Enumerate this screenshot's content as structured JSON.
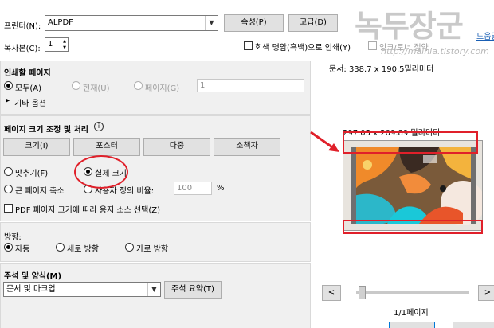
{
  "printer": {
    "label": "프린터(N):",
    "value": "ALPDF",
    "properties_label": "속성(P)",
    "advanced_label": "고급(D)"
  },
  "copies": {
    "label": "복사본(C):",
    "value": "1",
    "grayscale_label": "회색 명암(흑백)으로 인쇄(Y)",
    "save_ink_label": "잉크/토너 절약"
  },
  "watermark": {
    "text": "녹두장군",
    "url": "http://mainia.tistory.com"
  },
  "help_link": "도움말",
  "pages": {
    "heading": "인쇄할 페이지",
    "all_label": "모두(A)",
    "current_label": "현재(U)",
    "pages_label": "페이지(G)",
    "pages_value": "1",
    "more_options_label": "기타 옵션"
  },
  "sizing": {
    "heading": "페이지 크기 조정 및 처리",
    "info_icon_text": "i",
    "buttons": [
      "크기(I)",
      "포스터",
      "다중",
      "소책자"
    ],
    "fit_label": "맞추기(F)",
    "actual_size_label": "실제 크기",
    "shrink_label": "큰 페이지 축소",
    "custom_scale_label": "사용자 정의 비율:",
    "custom_scale_value": "100",
    "percent_sign": "%",
    "pdf_paper_label": "PDF 페이지 크기에 따라 용지 소스 선택(Z)"
  },
  "orientation": {
    "heading": "방향:",
    "auto_label": "자동",
    "portrait_label": "세로 방향",
    "landscape_label": "가로 방향"
  },
  "comments": {
    "heading": "주석 및 양식(M)",
    "select_value": "문서 및 마크업",
    "summarize_label": "주석 요약(T)"
  },
  "preview": {
    "doc_size": "문서: 338.7 x 190.5밀리미터",
    "paper_size": "297.05 x 209.89 밀리미터",
    "prev_glyph": "<",
    "next_glyph": ">",
    "page_counter": "1/1페이지"
  },
  "colors": {
    "annotation_red": "#e0202a",
    "panel_bg": "#f0f0f0"
  }
}
